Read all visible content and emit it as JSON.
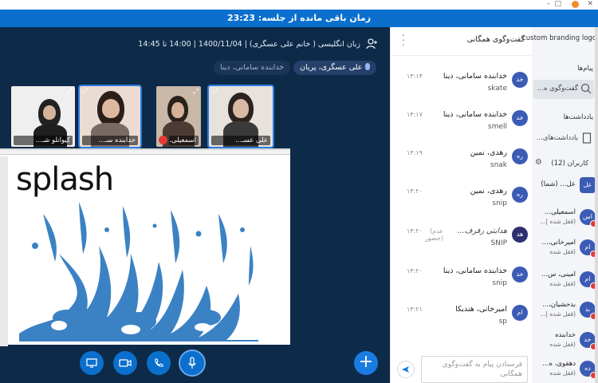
{
  "top_controls": [
    "–",
    "□",
    "✕"
  ],
  "timer_text": "زمان باقی مانده از جلسه: 23:23",
  "class_title": "زبان انگلیسی ( خانم علی عسگری) | 1400/11/04 | 14:00 تا 14:45",
  "speakers": [
    "علی عسگری، پریان",
    "خدابنده سامانی، دینا"
  ],
  "thumbnails": [
    {
      "name": "علی عسـ..."
    },
    {
      "name": "اسمعیلی..."
    },
    {
      "name": "خدابنده سـ..."
    },
    {
      "name": "کیوانلو شـ..."
    }
  ],
  "slide": {
    "word": "splash"
  },
  "chat": {
    "title": "گفت‌وگوی همگانی",
    "input_placeholder": "فرستادن پیام به گفت‌وگوی همگانی",
    "messages": [
      {
        "avatar": "خد",
        "name": "خدابنده سامانی، دینا",
        "time": "۱۴:۱۴",
        "text": "skate"
      },
      {
        "avatar": "خد",
        "name": "خدابنده سامانی، دینا",
        "time": "۱۴:۱۷",
        "text": "smell"
      },
      {
        "avatar": "ره",
        "name": "رهدی، نمین",
        "time": "۱۴:۱۹",
        "text": "snak"
      },
      {
        "avatar": "ره",
        "name": "رهدی، نمین",
        "time": "۱۴:۲۰",
        "text": "snip"
      },
      {
        "avatar": "هد",
        "name": "هدایتی رفرف...",
        "time": "۱۴:۲۰",
        "note": "(عدم حضور)",
        "text": "SNIP"
      },
      {
        "avatar": "خد",
        "name": "خدابنده سامانی، دینا",
        "time": "۱۴:۲۰",
        "text": "snip"
      },
      {
        "avatar": "ام",
        "name": "امیرخانی، هندیکا",
        "time": "۱۴:۲۱",
        "text": "sp"
      }
    ]
  },
  "sidebar": {
    "brand": "custom branding logo",
    "messages_label": "پیام‌ها",
    "public_chat_label": "گفت‌وگوی ه...",
    "notes_label": "یادداشت‌ها",
    "shared_notes_label": "یادداشت‌های...",
    "users_label": "کاربران (12)",
    "users": [
      {
        "avatar": "عل",
        "name": "عل... (شما)",
        "status": "",
        "color": "#3b5bb5"
      },
      {
        "avatar": "اس",
        "name": "اسمعیلی...",
        "status": "(قفل شده |...",
        "color": "#3b5bb5"
      },
      {
        "avatar": "ام",
        "name": "امیرخانی،...",
        "status": "(قفل شده",
        "color": "#3b5bb5"
      },
      {
        "avatar": "ام",
        "name": "امینی، س...",
        "status": "(قفل شده",
        "color": "#3b5bb5"
      },
      {
        "avatar": "بد",
        "name": "بدخشیان،...",
        "status": "(قفل شده |...",
        "color": "#3b5bb5"
      },
      {
        "avatar": "خد",
        "name": "خدابنده",
        "status": "(قفل شده",
        "color": "#3b5bb5"
      },
      {
        "avatar": "ده",
        "name": "دهقوی، ه...",
        "status": "(قفل شده",
        "color": "#3b5bb5"
      }
    ]
  },
  "colors": {
    "primary": "#0b6fcd",
    "stage": "#0d2a48",
    "splash": "#3b82c4"
  }
}
